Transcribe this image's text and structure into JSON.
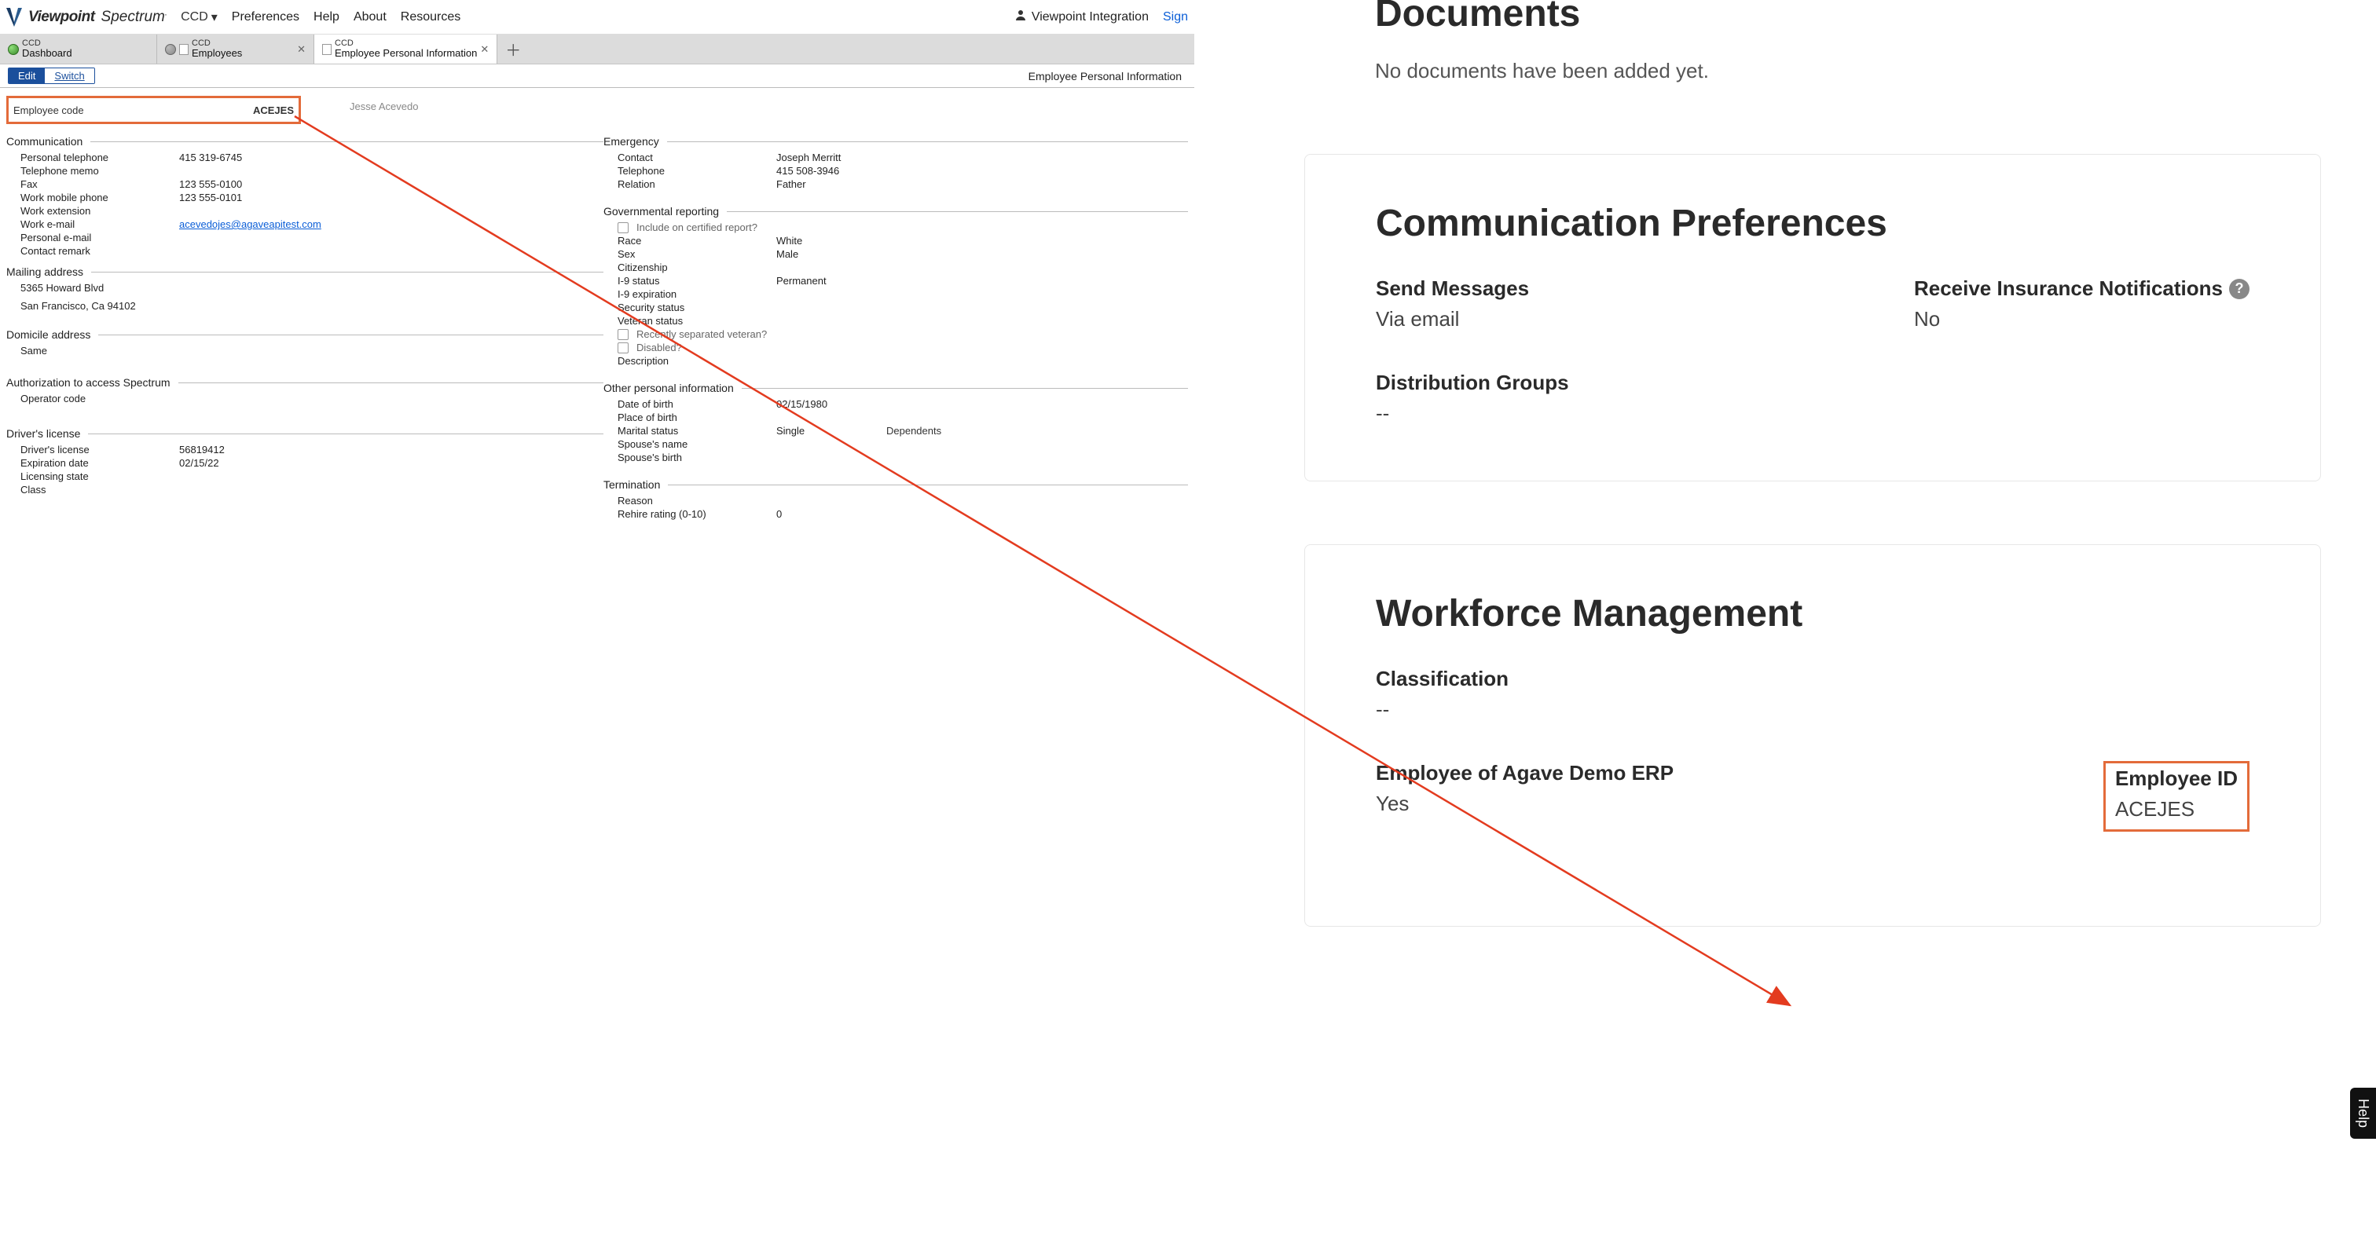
{
  "topbar": {
    "logo_text_1": "Viewpoint",
    "logo_text_2": "Spectrum",
    "logo_sub": ".",
    "ccd": "CCD",
    "nav": {
      "preferences": "Preferences",
      "help": "Help",
      "about": "About",
      "resources": "Resources"
    },
    "user": "Viewpoint Integration",
    "signout": "Sign"
  },
  "tabs": [
    {
      "sup": "CCD",
      "label": "Dashboard"
    },
    {
      "sup": "CCD",
      "label": "Employees"
    },
    {
      "sup": "CCD",
      "label": "Employee Personal Information"
    }
  ],
  "toolbar": {
    "edit": "Edit",
    "switch": "Switch",
    "title": "Employee Personal Information"
  },
  "employee": {
    "code_label": "Employee code",
    "code_value": "ACEJES",
    "name": "Jesse Acevedo"
  },
  "sections": {
    "communication": "Communication",
    "mailing_address": "Mailing address",
    "domicile_address": "Domicile address",
    "auth": "Authorization to access Spectrum",
    "drivers_license": "Driver's license",
    "emergency": "Emergency",
    "gov_reporting": "Governmental reporting",
    "other_personal": "Other personal information",
    "termination": "Termination"
  },
  "communication": {
    "personal_telephone_k": "Personal telephone",
    "personal_telephone_v": "415 319-6745",
    "telephone_memo_k": "Telephone memo",
    "telephone_memo_v": "",
    "fax_k": "Fax",
    "fax_v": "123 555-0100",
    "work_mobile_k": "Work mobile phone",
    "work_mobile_v": "123 555-0101",
    "work_ext_k": "Work extension",
    "work_ext_v": "",
    "work_email_k": "Work e-mail",
    "work_email_v": "acevedojes@agaveapitest.com",
    "personal_email_k": "Personal e-mail",
    "personal_email_v": "",
    "contact_remark_k": "Contact remark",
    "contact_remark_v": ""
  },
  "mailing": {
    "line1": "5365 Howard  Blvd",
    "line2": "San Francisco, Ca 94102"
  },
  "domicile": {
    "same": "Same"
  },
  "auth": {
    "operator_code_k": "Operator code",
    "operator_code_v": ""
  },
  "license": {
    "number_k": "Driver's license",
    "number_v": "56819412",
    "expiration_k": "Expiration date",
    "expiration_v": "02/15/22",
    "licensing_state_k": "Licensing state",
    "licensing_state_v": "",
    "class_k": "Class",
    "class_v": ""
  },
  "emergency": {
    "contact_k": "Contact",
    "contact_v": "Joseph Merritt",
    "telephone_k": "Telephone",
    "telephone_v": "415 508-3946",
    "relation_k": "Relation",
    "relation_v": "Father"
  },
  "gov": {
    "include_certified": "Include on certified report?",
    "race_k": "Race",
    "race_v": "White",
    "sex_k": "Sex",
    "sex_v": "Male",
    "citizenship_k": "Citizenship",
    "citizenship_v": "",
    "i9_status_k": "I-9 status",
    "i9_status_v": "Permanent",
    "i9_exp_k": "I-9 expiration",
    "i9_exp_v": "",
    "security_status_k": "Security status",
    "security_status_v": "",
    "veteran_status_k": "Veteran status",
    "veteran_status_v": "",
    "recently_separated": "Recently separated veteran?",
    "disabled": "Disabled?",
    "description_k": "Description",
    "description_v": ""
  },
  "other": {
    "dob_k": "Date of birth",
    "dob_v": "02/15/1980",
    "pob_k": "Place of birth",
    "pob_v": "",
    "marital_k": "Marital status",
    "marital_v": "Single",
    "dependents_k": "Dependents",
    "spouse_name_k": "Spouse's name",
    "spouse_name_v": "",
    "spouse_birth_k": "Spouse's birth",
    "spouse_birth_v": ""
  },
  "termination": {
    "reason_k": "Reason",
    "reason_v": "",
    "rehire_k": "Rehire rating (0-10)",
    "rehire_v": "0"
  },
  "right": {
    "documents_title": "Documents",
    "documents_empty": "No documents have been added yet.",
    "comm_prefs_title": "Communication Preferences",
    "send_messages_label": "Send Messages",
    "send_messages_value": "Via email",
    "receive_ins_label": "Receive Insurance Notifications",
    "receive_ins_value": "No",
    "dist_groups_label": "Distribution Groups",
    "dist_groups_value": "--",
    "workforce_title": "Workforce Management",
    "classification_label": "Classification",
    "classification_value": "--",
    "employee_of_label": "Employee of Agave Demo ERP",
    "employee_of_value": "Yes",
    "employee_id_label": "Employee ID",
    "employee_id_value": "ACEJES"
  },
  "help_tab": "Help"
}
